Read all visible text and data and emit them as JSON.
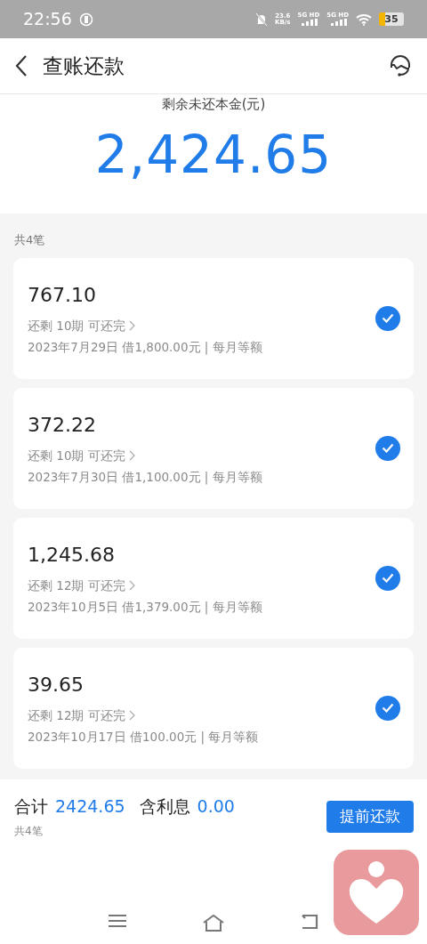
{
  "status_bar": {
    "time": "22:56",
    "speed": "23.6",
    "speed_unit": "KB/s",
    "sim1": "5G HD",
    "sim2": "5G HD",
    "battery": "35"
  },
  "header": {
    "title": "查账还款"
  },
  "summary": {
    "label": "剩余未还本金(元)",
    "amount": "2,424.65"
  },
  "count_label": "共4笔",
  "loans": [
    {
      "amount": "767.10",
      "remaining": "还剩 10期 可还完",
      "detail": "2023年7月29日 借1,800.00元 | 每月等额",
      "selected": true
    },
    {
      "amount": "372.22",
      "remaining": "还剩 10期 可还完",
      "detail": "2023年7月30日 借1,100.00元 | 每月等额",
      "selected": true
    },
    {
      "amount": "1,245.68",
      "remaining": "还剩 12期 可还完",
      "detail": "2023年10月5日 借1,379.00元 | 每月等额",
      "selected": true
    },
    {
      "amount": "39.65",
      "remaining": "还剩 12期 可还完",
      "detail": "2023年10月17日 借100.00元 | 每月等额",
      "selected": true
    }
  ],
  "footer": {
    "total_label": "合计",
    "total": "2424.65",
    "interest_label": "含利息",
    "interest": "0.00",
    "count": "共4笔",
    "button": "提前还款"
  }
}
